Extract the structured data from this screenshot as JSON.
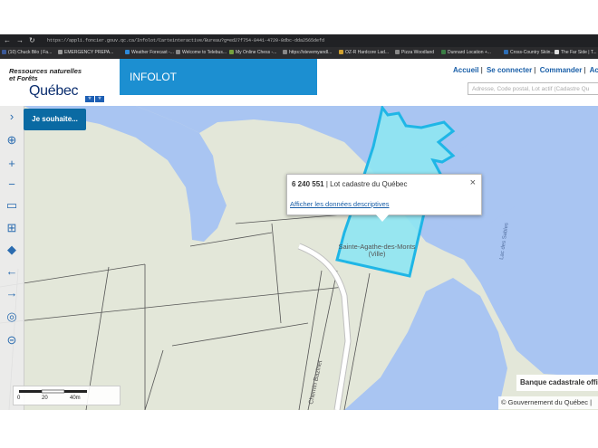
{
  "browser": {
    "url": "https://appli.foncier.gouv.qc.ca/Infolot/Carteinteractive/Bureau?g=ed27f754-8441-4720-8dbc-dda2565defd",
    "bookmarks": [
      {
        "label": "(10) Chuck Bilo | Fa...",
        "color": "#3b5998"
      },
      {
        "label": "EMERGENCY PREPA...",
        "color": "#999999"
      },
      {
        "label": "Weather Forecast -...",
        "color": "#2d88d8"
      },
      {
        "label": "Welcome to Telebus...",
        "color": "#888888"
      },
      {
        "label": "My Online Chess -...",
        "color": "#76a13f"
      },
      {
        "label": "https://stevemyandl...",
        "color": "#888888"
      },
      {
        "label": "OZ-R Hardcore Lad...",
        "color": "#d0a030"
      },
      {
        "label": "Pizza Woodland",
        "color": "#888888"
      },
      {
        "label": "Dunnard Location +...",
        "color": "#3a7d44"
      },
      {
        "label": "Cross-Country Skiin...",
        "color": "#2d6db5"
      },
      {
        "label": "The Far Side | T...",
        "color": "#dddddd"
      }
    ]
  },
  "header": {
    "logo_line1": "Ressources naturelles",
    "logo_line2": "et Forêts",
    "logo_quebec": "Québec",
    "app_title": "INFOLOT",
    "links": [
      "Accueil",
      "Se connecter",
      "Commander",
      "Ac"
    ],
    "search_placeholder": "Adresse, Code postal, Lot actif (Cadastre Qu"
  },
  "toolbar": {
    "wish_button": "Je souhaite...",
    "tools": [
      {
        "icon": "chevron-right-icon",
        "glyph": "›"
      },
      {
        "icon": "locate-icon",
        "glyph": "⊕"
      },
      {
        "icon": "zoom-in-icon",
        "glyph": "+"
      },
      {
        "icon": "zoom-out-icon",
        "glyph": "−"
      },
      {
        "icon": "book-icon",
        "glyph": "▭"
      },
      {
        "icon": "zoom-extent-icon",
        "glyph": "⊞"
      },
      {
        "icon": "quebec-map-icon",
        "glyph": "◆"
      },
      {
        "icon": "back-arrow-icon",
        "glyph": "←"
      },
      {
        "icon": "forward-arrow-icon",
        "glyph": "→"
      },
      {
        "icon": "globe-search-icon",
        "glyph": "◎"
      },
      {
        "icon": "magnify-icon",
        "glyph": "⊝"
      }
    ]
  },
  "popup": {
    "lot_number": "6 240 551",
    "lot_type": " | Lot cadastre du Québec",
    "link": "Afficher les données descriptives",
    "close": "×"
  },
  "map": {
    "label_municipality": "Sainte-Agathe-des-Monts",
    "label_ville": "(Ville)",
    "label_road": "Chemin Bazinet",
    "label_lake": "Lac des Sables",
    "colors": {
      "water": "#a9c5f2",
      "land": "#e3e7d9",
      "lot_fill": "#8ee6f2",
      "lot_border": "#1fb6e6"
    }
  },
  "scale": {
    "ticks": [
      "0",
      "20",
      "40m"
    ]
  },
  "attribution": {
    "cadastral": "Banque cadastrale offi",
    "copyright": "© Gouvernement du Québec |"
  }
}
